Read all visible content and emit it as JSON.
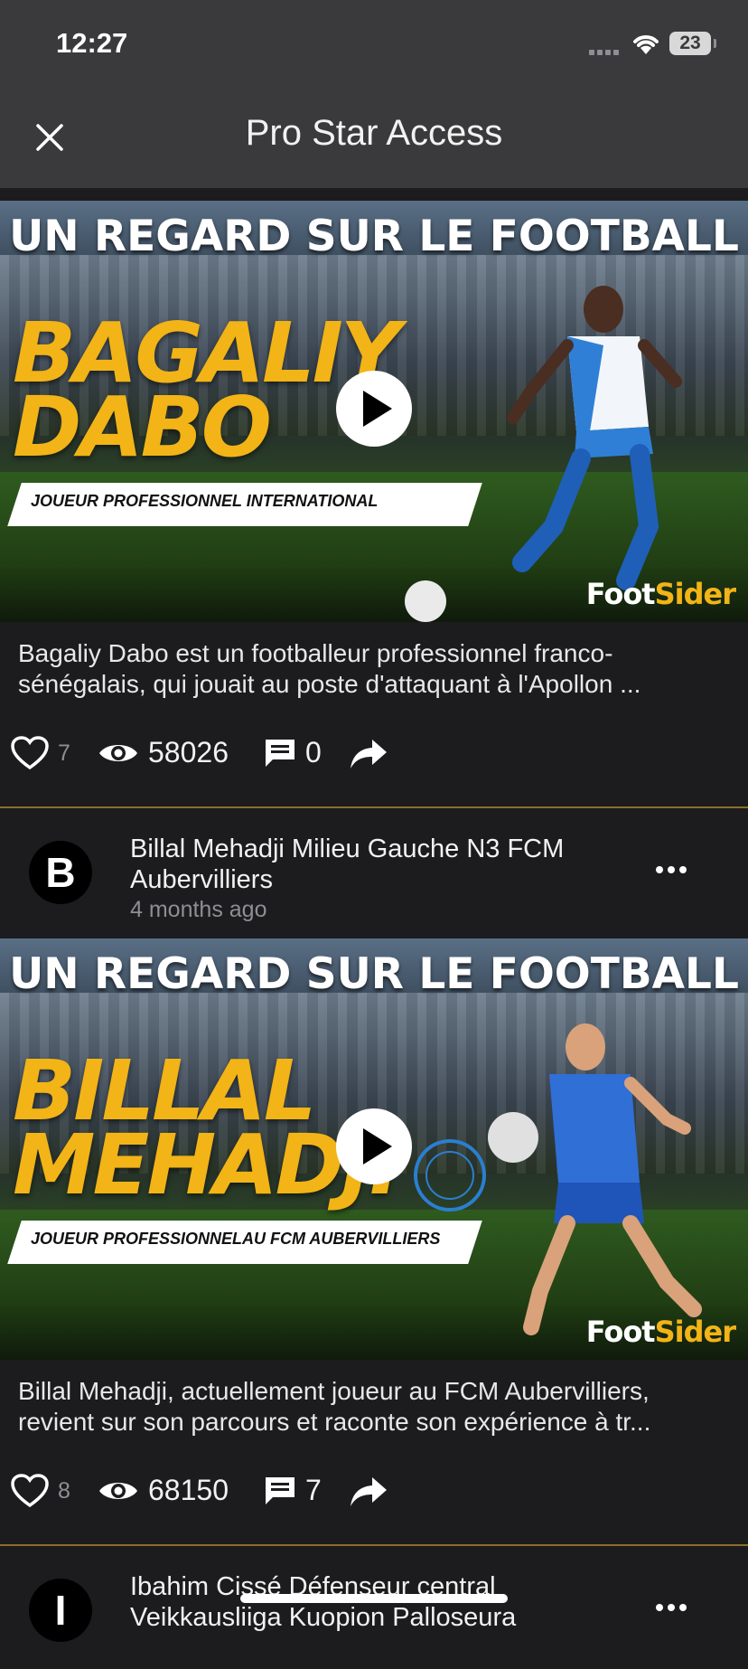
{
  "status_bar": {
    "time": "12:27",
    "battery": "23"
  },
  "nav": {
    "title": "Pro Star Access"
  },
  "brand": {
    "part1": "Foot",
    "part2": "Sider"
  },
  "posts": [
    {
      "headline": "UN REGARD SUR LE FOOTBALL",
      "name_line1": "BAGALIY",
      "name_line2": "DABO",
      "role": "JOUEUR PROFESSIONNEL INTERNATIONAL",
      "desc_line1": "Bagaliy Dabo est un footballeur professionnel franco-",
      "desc_line2": "sénégalais, qui jouait au poste d'attaquant à l'Apollon ...",
      "likes": "7",
      "views": "58026",
      "comments": "0"
    },
    {
      "author_initial": "B",
      "author_line1": "Billal Mehadji Milieu Gauche N3 FCM",
      "author_line2": "Aubervilliers",
      "time_ago": "4 months ago",
      "headline": "UN REGARD SUR LE FOOTBALL",
      "name_line1": "BILLAL",
      "name_line2": "MEHADJI",
      "role": "JOUEUR PROFESSIONNELAU FCM AUBERVILLIERS",
      "desc_line1": "Billal Mehadji, actuellement joueur au FCM Aubervilliers,",
      "desc_line2": "revient sur son parcours et raconte son expérience à tr...",
      "likes": "8",
      "views": "68150",
      "comments": "7"
    },
    {
      "author_initial": "I",
      "author_line1": "Ibahim Cissé Défenseur central",
      "author_line2": "Veikkausliiga Kuopion Palloseura"
    }
  ]
}
